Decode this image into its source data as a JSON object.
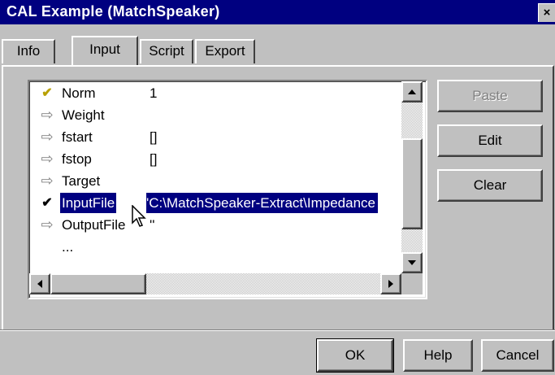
{
  "window": {
    "title": "CAL Example (MatchSpeaker)",
    "close_label": "×"
  },
  "tabs": [
    {
      "label": "Info",
      "active": false
    },
    {
      "label": "Input",
      "active": true
    },
    {
      "label": "Script",
      "active": false
    },
    {
      "label": "Export",
      "active": false
    }
  ],
  "list": {
    "rows": [
      {
        "icon": "check-icon",
        "name": "Norm",
        "value": "1",
        "selected": false
      },
      {
        "icon": "arrow-right-icon",
        "name": "Weight",
        "value": "",
        "selected": false
      },
      {
        "icon": "arrow-right-icon",
        "name": "fstart",
        "value": "[]",
        "selected": false
      },
      {
        "icon": "arrow-right-icon",
        "name": "fstop",
        "value": "[]",
        "selected": false
      },
      {
        "icon": "arrow-right-icon",
        "name": "Target",
        "value": "",
        "selected": false
      },
      {
        "icon": "check-icon",
        "name": "InputFile",
        "value": "'C:\\MatchSpeaker-Extract\\Impedance",
        "selected": true
      },
      {
        "icon": "arrow-right-icon",
        "name": "OutputFile",
        "value": "''",
        "selected": false
      },
      {
        "icon": "",
        "name": "...",
        "value": "",
        "selected": false
      }
    ]
  },
  "side_buttons": {
    "paste": {
      "label": "Paste",
      "enabled": false
    },
    "edit": {
      "label": "Edit",
      "enabled": true
    },
    "clear": {
      "label": "Clear",
      "enabled": true
    }
  },
  "dialog_buttons": {
    "ok": "OK",
    "help": "Help",
    "cancel": "Cancel"
  },
  "colors": {
    "titlebar": "#000080",
    "selection": "#000080",
    "check_mark": "#b8a000",
    "face": "#c0c0c0"
  }
}
